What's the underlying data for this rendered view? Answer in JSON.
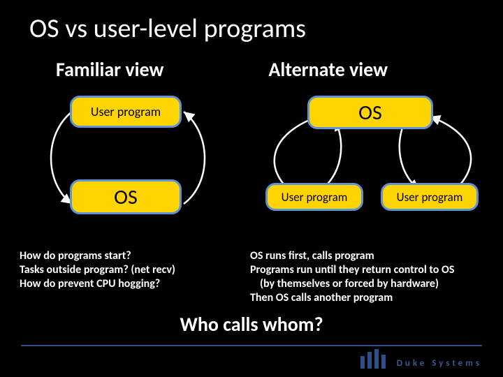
{
  "title": "OS vs user-level programs",
  "columns": {
    "left": "Familiar view",
    "right": "Alternate view"
  },
  "boxes": {
    "user_left": "User program",
    "os_left": "OS",
    "os_right": "OS",
    "user_r1": "User program",
    "user_r2": "User program"
  },
  "notes": {
    "left": {
      "l1": "How do programs start?",
      "l2": "Tasks outside program? (net recv)",
      "l3": "How do prevent CPU hogging?"
    },
    "right": {
      "l1": "OS runs first, calls program",
      "l2": "Programs run until they return control to OS",
      "l3": "(by themselves or forced by hardware)",
      "l4": "Then OS calls another program"
    }
  },
  "closing": "Who calls whom?",
  "brand": "Duke Systems"
}
